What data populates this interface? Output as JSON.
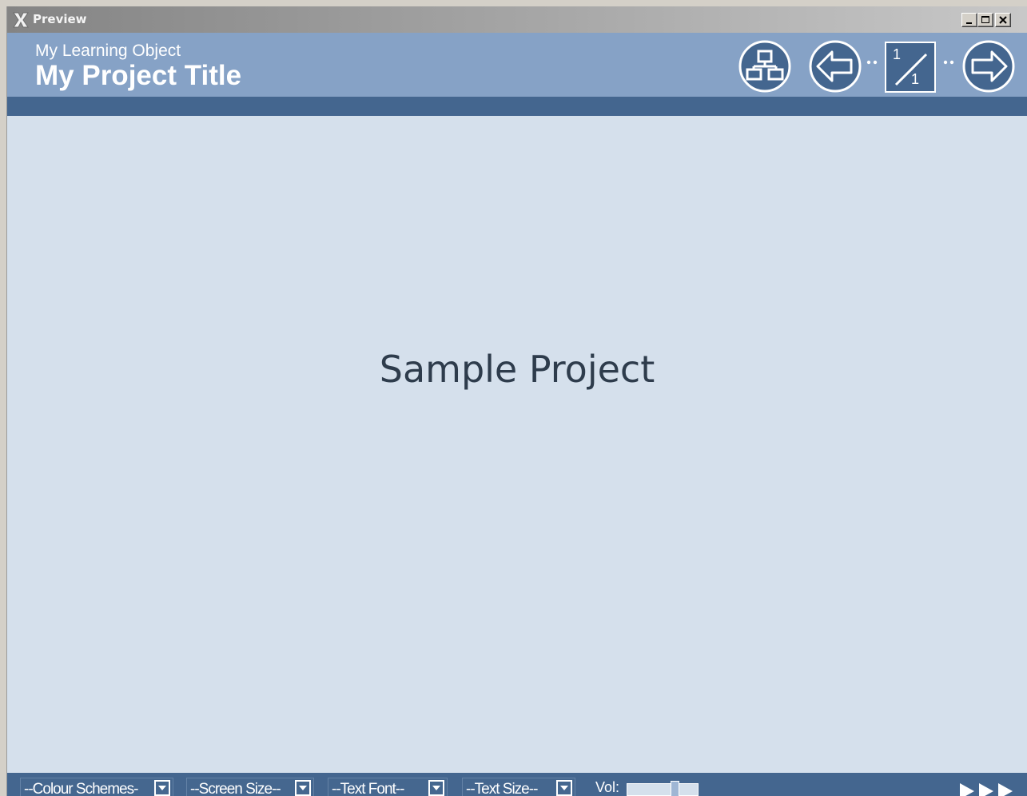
{
  "window": {
    "title": "Preview",
    "icons": {
      "app": "xerte-x-icon",
      "minimize": "minimize-icon",
      "maximize": "maximize-icon",
      "close": "close-icon"
    }
  },
  "header": {
    "subtitle": "My Learning Object",
    "title": "My Project Title",
    "nav": {
      "glossary_icon": "sitemap-icon",
      "prev_icon": "arrow-left-icon",
      "next_icon": "arrow-right-icon",
      "page_current": "1",
      "page_total": "1"
    }
  },
  "content": {
    "text": "Sample Project"
  },
  "footer": {
    "colour_schemes": "--Colour Schemes-",
    "screen_size": "--Screen Size--",
    "text_font": "--Text Font--",
    "text_size": "--Text Size--",
    "volume_label": "Vol:",
    "play_icon": "triple-play-icon"
  },
  "colors": {
    "header_bg": "#86a2c6",
    "stripe_bg": "#44668f",
    "content_bg": "#d5e0ec",
    "content_text": "#2e3c4c"
  }
}
